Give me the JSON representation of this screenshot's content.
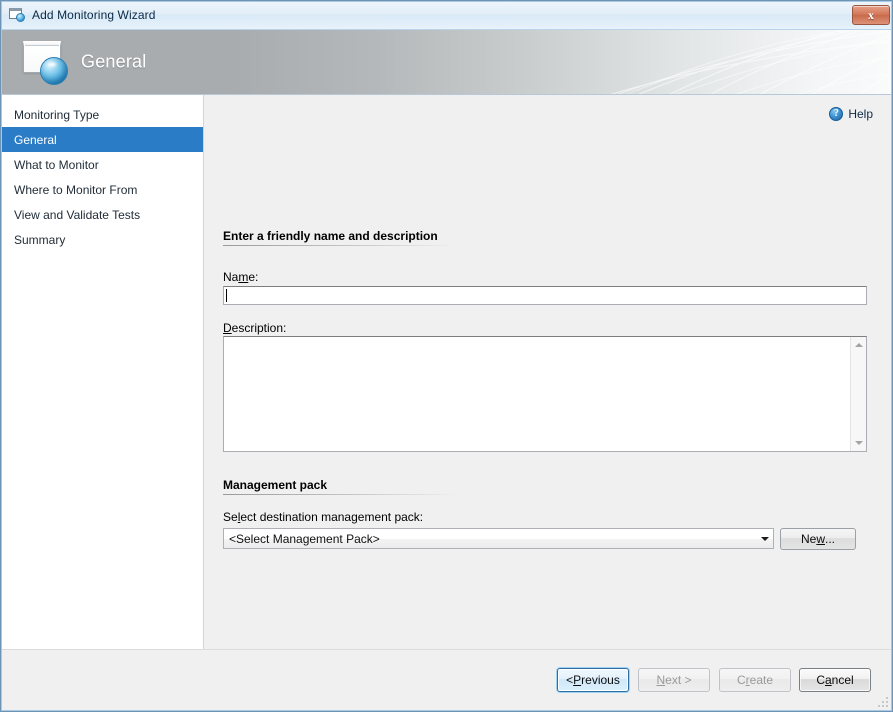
{
  "window": {
    "title": "Add Monitoring Wizard",
    "title_icon": "wizard-window-ball-icon",
    "close_label": "x",
    "frame_accent": "#a8c8e4"
  },
  "banner": {
    "title": "General",
    "icon": "wizard-window-ball-icon"
  },
  "sidebar": {
    "items": [
      {
        "label": "Monitoring Type",
        "active": false
      },
      {
        "label": "General",
        "active": true
      },
      {
        "label": "What to Monitor",
        "active": false
      },
      {
        "label": "Where to Monitor From",
        "active": false
      },
      {
        "label": "View and Validate Tests",
        "active": false
      },
      {
        "label": "Summary",
        "active": false
      }
    ],
    "active_color": "#2a7cc7"
  },
  "help": {
    "label": "Help",
    "icon": "help-question-icon",
    "glyph": "?"
  },
  "main": {
    "section_friendly": {
      "heading": "Enter a friendly name and description"
    },
    "name": {
      "label_pre": "Na",
      "label_acc": "m",
      "label_post": "e:",
      "value": "",
      "placeholder": ""
    },
    "description": {
      "label_acc": "D",
      "label_post": "escription:",
      "value": "",
      "placeholder": ""
    },
    "section_mp": {
      "heading": "Management pack"
    },
    "management_pack": {
      "label_pre": "Se",
      "label_acc": "l",
      "label_post": "ect destination management pack:",
      "selected": "<Select Management Pack>",
      "options": [
        "<Select Management Pack>"
      ]
    },
    "new_button": {
      "label_pre": "Ne",
      "label_acc": "w",
      "label_post": "..."
    }
  },
  "footer": {
    "buttons": [
      {
        "pre": "< ",
        "acc": "P",
        "post": "revious",
        "state": "focused"
      },
      {
        "pre": "",
        "acc": "N",
        "post": "ext >",
        "state": "disabled"
      },
      {
        "pre": "C",
        "acc": "r",
        "post": "eate",
        "state": "disabled"
      },
      {
        "pre": "C",
        "acc": "a",
        "post": "ncel",
        "state": "hover"
      }
    ]
  }
}
